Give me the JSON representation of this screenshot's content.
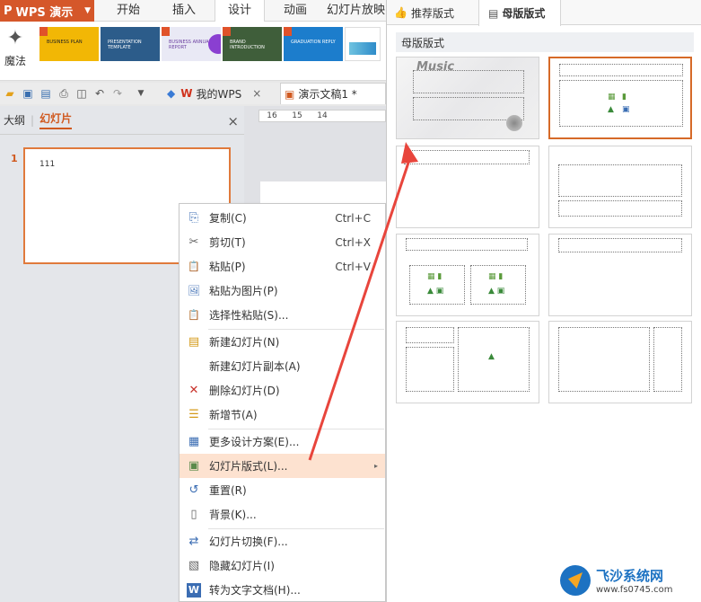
{
  "app": {
    "name": "WPS 演示",
    "caret": "▼"
  },
  "ribbon_tabs": [
    "开始",
    "插入",
    "设计",
    "动画",
    "幻灯片放映"
  ],
  "ribbon": {
    "magic_label": "魔法",
    "thumbs": [
      {
        "color": "#f2b705",
        "caption": "BUSINESS PLAN"
      },
      {
        "color": "#2c5c8a",
        "caption": "PRESENTATION TEMPLATE"
      },
      {
        "color": "#e9e9f5",
        "caption": "BUSINESS ANNUAL REPORT"
      },
      {
        "color": "#3f5e3a",
        "caption": "BRAND INTRODUCTION"
      },
      {
        "color": "#1c7dcc",
        "caption": "GRADUATION REPLY"
      },
      {
        "color": "#ffffff",
        "caption": ""
      }
    ]
  },
  "doctabs": {
    "my_wps": "我的WPS",
    "doc": "演示文稿1 *",
    "close": "×"
  },
  "left_pane": {
    "tab_outline": "大纲",
    "tab_slides": "幻灯片",
    "close": "×",
    "slide_number": "1",
    "slide_text": "111"
  },
  "ruler": [
    "16",
    "15",
    "14"
  ],
  "context_menu": [
    {
      "icon": "copy-icon",
      "glyph": "⎘",
      "label": "复制(C)",
      "shortcut": "Ctrl+C"
    },
    {
      "icon": "cut-icon",
      "glyph": "✂",
      "label": "剪切(T)",
      "shortcut": "Ctrl+X"
    },
    {
      "icon": "paste-icon",
      "glyph": "📋",
      "label": "粘贴(P)",
      "shortcut": "Ctrl+V"
    },
    {
      "icon": "paste-as-picture-icon",
      "glyph": "🖼",
      "label": "粘贴为图片(P)",
      "shortcut": ""
    },
    {
      "icon": "paste-special-icon",
      "glyph": "📋",
      "label": "选择性粘贴(S)...",
      "shortcut": ""
    },
    {
      "icon": "new-slide-icon",
      "glyph": "▤",
      "label": "新建幻灯片(N)",
      "shortcut": ""
    },
    {
      "icon": "",
      "glyph": "",
      "label": "新建幻灯片副本(A)",
      "shortcut": ""
    },
    {
      "icon": "delete-slide-icon",
      "glyph": "✕",
      "label": "删除幻灯片(D)",
      "shortcut": ""
    },
    {
      "icon": "new-section-icon",
      "glyph": "☰",
      "label": "新增节(A)",
      "shortcut": ""
    },
    {
      "icon": "design-scheme-icon",
      "glyph": "▦",
      "label": "更多设计方案(E)...",
      "shortcut": ""
    },
    {
      "icon": "slide-layout-icon",
      "glyph": "▣",
      "label": "幻灯片版式(L)...",
      "shortcut": ""
    },
    {
      "icon": "reset-icon",
      "glyph": "↺",
      "label": "重置(R)",
      "shortcut": ""
    },
    {
      "icon": "background-icon",
      "glyph": "▯",
      "label": "背景(K)...",
      "shortcut": ""
    },
    {
      "icon": "slide-transition-icon",
      "glyph": "⇄",
      "label": "幻灯片切换(F)...",
      "shortcut": ""
    },
    {
      "icon": "hide-slide-icon",
      "glyph": "▧",
      "label": "隐藏幻灯片(I)",
      "shortcut": ""
    },
    {
      "icon": "convert-to-doc-icon",
      "glyph": "W",
      "label": "转为文字文档(H)...",
      "shortcut": ""
    }
  ],
  "submenu_caret": "▸",
  "right_panel": {
    "tab_recommended": "推荐版式",
    "tab_master": "母版版式",
    "section_title": "母版版式",
    "music_text": "Music"
  },
  "watermark": {
    "title": "飞沙系统网",
    "url": "www.fs0745.com"
  },
  "colors": {
    "accent": "#d0591f",
    "highlight": "#fde2d0",
    "arrow": "#e8453c"
  }
}
